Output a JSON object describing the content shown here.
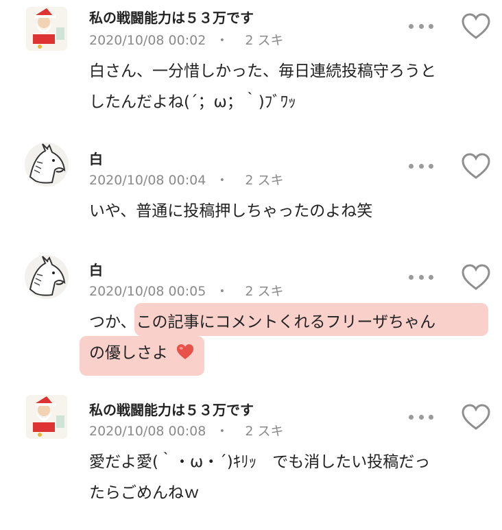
{
  "comments": [
    {
      "author": "私の戦闘能力は５３万です",
      "date": "2020/10/08 00:02",
      "likes": "2 スキ",
      "lines": [
        "白さん、一分惜しかった、毎日連続投稿守ろうと",
        "したんだよね(´；ω；｀)ﾌﾞﾜｯ"
      ]
    },
    {
      "author": "白",
      "date": "2020/10/08 00:04",
      "likes": "2 スキ",
      "lines": [
        "いや、普通に投稿押しちゃったのよね笑"
      ]
    },
    {
      "author": "白",
      "date": "2020/10/08 00:05",
      "likes": "2 スキ",
      "lines": [
        "つか、この記事にコメントくれるフリーザちゃん",
        "の優しさよ"
      ],
      "emoji": "❤️"
    },
    {
      "author": "私の戦闘能力は５３万です",
      "date": "2020/10/08 00:08",
      "likes": "2 スキ",
      "lines": [
        "愛だよ愛(｀・ω・´)ｷﾘｯ　でも消したい投稿だっ",
        "たらごめんねｗ"
      ]
    }
  ],
  "separator": "・"
}
